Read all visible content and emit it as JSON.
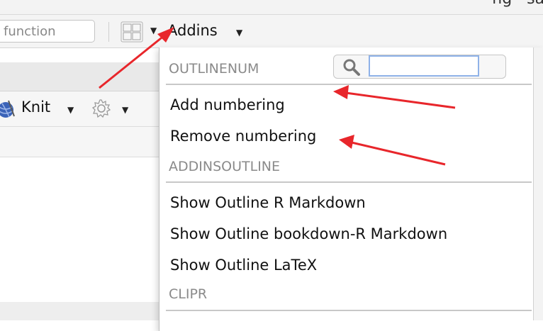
{
  "window": {
    "title_fragment": "ng · sang"
  },
  "toolbar": {
    "goto_placeholder": "function",
    "addins_label": "Addins",
    "grid_icon": "grid-icon",
    "caret_icon": "caret-down-icon"
  },
  "editor": {
    "knit_label": "Knit",
    "knit_icon": "knit-yarn-icon",
    "settings_icon": "gear-icon"
  },
  "addins_menu": {
    "search_icon": "search-icon",
    "search_value": "",
    "sections": [
      {
        "header": "OUTLINENUM",
        "items": [
          "Add numbering",
          "Remove numbering"
        ]
      },
      {
        "header": "ADDINSOUTLINE",
        "items": [
          "Show Outline R Markdown",
          "Show Outline bookdown-R Markdown",
          "Show Outline LaTeX"
        ]
      },
      {
        "header": "CLIPR",
        "items": []
      }
    ]
  },
  "annotations": {
    "arrow_color": "#e8262b",
    "arrow_count": 3
  },
  "colors": {
    "menu_header": "#8a8a8a",
    "search_focus": "#8fb2e8"
  }
}
